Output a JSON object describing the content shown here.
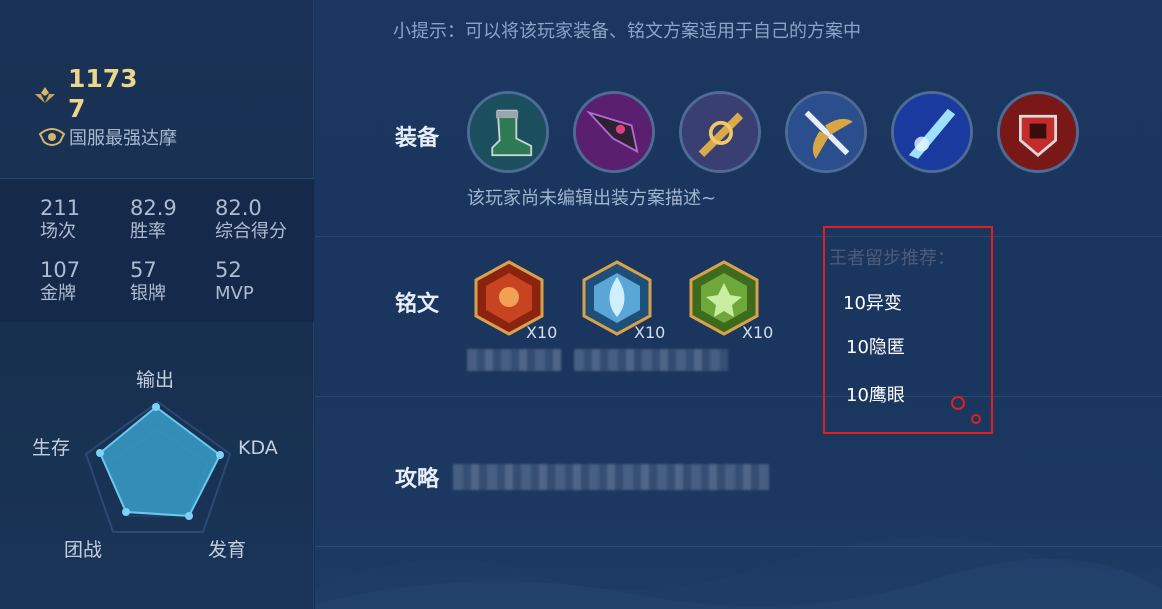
{
  "player": {
    "score": "1173 7",
    "rank_title": "国服最强达摩"
  },
  "stats": [
    {
      "value": "211",
      "label": "场次"
    },
    {
      "value": "82.9",
      "label": "胜率"
    },
    {
      "value": "82.0",
      "label": "综合得分"
    },
    {
      "value": "107",
      "label": "金牌"
    },
    {
      "value": "57",
      "label": "银牌"
    },
    {
      "value": "52",
      "label": "MVP"
    }
  ],
  "radar": {
    "labels": {
      "top": "输出",
      "right": "KDA",
      "bottom_right": "发育",
      "bottom_left": "团战",
      "left": "生存"
    }
  },
  "tip": "小提示：可以将该玩家装备、铭文方案适用于自己的方案中",
  "equipment": {
    "label": "装备",
    "items": [
      "boots-item-icon",
      "dark-axe-item-icon",
      "golden-blade-item-icon",
      "winged-sword-item-icon",
      "ice-blade-item-icon",
      "red-armor-item-icon"
    ],
    "description": "该玩家尚未编辑出装方案描述~"
  },
  "runes": {
    "label": "铭文",
    "items": [
      {
        "icon": "red-rune-icon",
        "count": "X10",
        "color": "#c8431f"
      },
      {
        "icon": "blue-rune-icon",
        "count": "X10",
        "color": "#5aa6d6"
      },
      {
        "icon": "green-rune-icon",
        "count": "X10",
        "color": "#6fa83a"
      }
    ]
  },
  "strategy": {
    "label": "攻略"
  },
  "recommendation": {
    "title": "王者留步推荐：",
    "items": [
      "10异变",
      "10隐匿",
      "10鹰眼"
    ]
  },
  "colors": {
    "accent_gold": "#ecd58d",
    "highlight_red": "#e02020",
    "background": "#18315a"
  }
}
